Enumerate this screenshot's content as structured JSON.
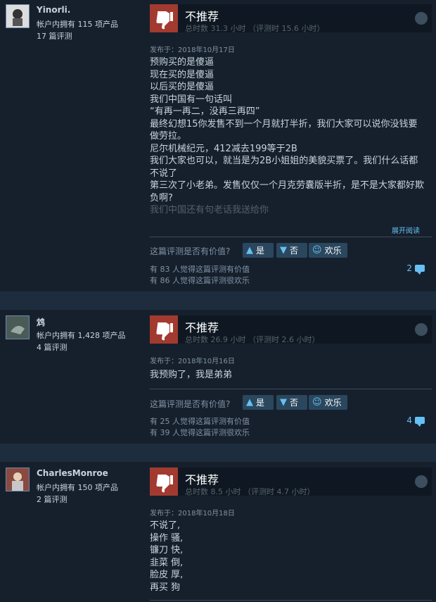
{
  "reviews": [
    {
      "user": "Yinorli.",
      "products": "帐户内拥有 115 项产品",
      "reviews_count": "17 篇评测",
      "verdict": "不推荐",
      "hours": "总时数 31.3 小时 （评测时 15.6 小时）",
      "posted": "发布于：2018年10月17日",
      "lines": [
        "预购买的是傻逼",
        "现在买的是傻逼",
        "以后买的是傻逼",
        "我们中国有一句话叫",
        "“有再一再二，没再三再四”",
        "最终幻想15你发售不到一个月就打半折，我们大家可以说你没钱要做劳拉。",
        "尼尔机械纪元，412减去199等于2B",
        "我们大家也可以，就当是为2B小姐姐的美貌买票了。我们什么话都不说了",
        "第三次了小老弟。发售仅仅一个月克劳囊版半折，是不是大家都好欺负啊?"
      ],
      "faded_line": "我们中国还有句老话我送给你",
      "read_more": "展开阅读",
      "helpful_q": "这篇评测是否有价值?",
      "yes": "是",
      "no": "否",
      "funny": "欢乐",
      "helpful_stat": "有 83 人觉得这篇评测有价值",
      "funny_stat": "有 86 人觉得这篇评测很欢乐",
      "comments": "2"
    },
    {
      "user": "鸩",
      "products": "帐户内拥有 1,428 项产品",
      "reviews_count": "4 篇评测",
      "verdict": "不推荐",
      "hours": "总时数 26.9 小时 （评测时 2.6 小时）",
      "posted": "发布于：2018年10月16日",
      "lines": [
        "我预购了，我是弟弟"
      ],
      "helpful_q": "这篇评测是否有价值?",
      "yes": "是",
      "no": "否",
      "funny": "欢乐",
      "helpful_stat": "有 25 人觉得这篇评测有价值",
      "funny_stat": "有 39 人觉得这篇评测很欢乐",
      "comments": "4"
    },
    {
      "user": "CharlesMonroe",
      "products": "帐户内拥有 150 项产品",
      "reviews_count": "2 篇评测",
      "verdict": "不推荐",
      "hours": "总时数 8.5 小时 （评测时 4.7 小时）",
      "posted": "发布于：2018年10月18日",
      "lines": [
        "不说了,",
        "操作 骚,",
        "镰刀 快,",
        "韭菜 倒,",
        "脸皮 厚,",
        "再买 狗"
      ]
    }
  ],
  "icons": {
    "thumb_down": "thumbs-down-icon",
    "thumb_up": "thumbs-up-icon",
    "funny": "smiley-icon",
    "comment": "comment-icon",
    "steam": "steam-icon"
  },
  "colors": {
    "negative": "#a33a2f",
    "accent": "#66c0f4",
    "panel": "#16202d"
  }
}
